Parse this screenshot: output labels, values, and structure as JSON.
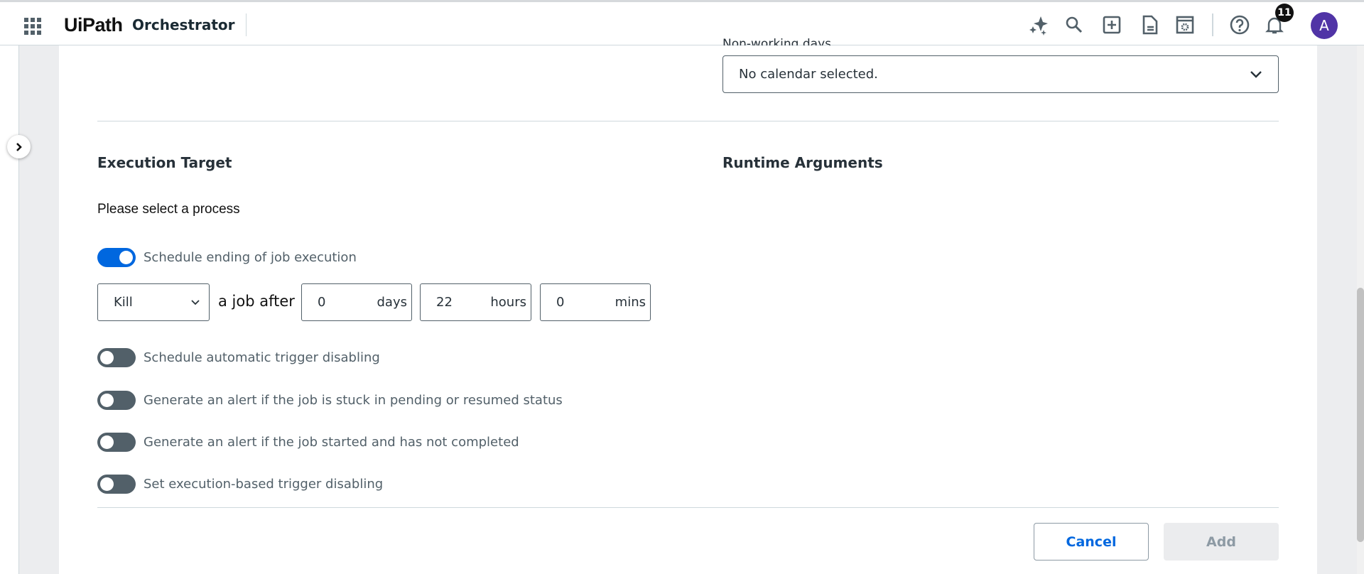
{
  "header": {
    "logo_text": "UiPath",
    "product": "Orchestrator",
    "notification_count": "11",
    "avatar_initial": "A"
  },
  "calendar": {
    "label_partial": "Non-working days",
    "value": "No calendar selected."
  },
  "execution_target": {
    "title": "Execution Target",
    "process_prompt": "Please select a process"
  },
  "runtime_arguments": {
    "title": "Runtime Arguments"
  },
  "schedule_ending": {
    "label": "Schedule ending of job execution",
    "enabled": true,
    "action": "Kill",
    "connector": "a job after",
    "days_value": "0",
    "days_unit": "days",
    "hours_value": "22",
    "hours_unit": "hours",
    "mins_value": "0",
    "mins_unit": "mins"
  },
  "toggles": [
    {
      "label": "Schedule automatic trigger disabling",
      "enabled": false
    },
    {
      "label": "Generate an alert if the job is stuck in pending or resumed status",
      "enabled": false
    },
    {
      "label": "Generate an alert if the job started and has not completed",
      "enabled": false
    },
    {
      "label": "Set execution-based trigger disabling",
      "enabled": false
    }
  ],
  "footer": {
    "cancel": "Cancel",
    "add": "Add"
  },
  "colors": {
    "accent": "#0067df",
    "avatar": "#5034a6"
  }
}
